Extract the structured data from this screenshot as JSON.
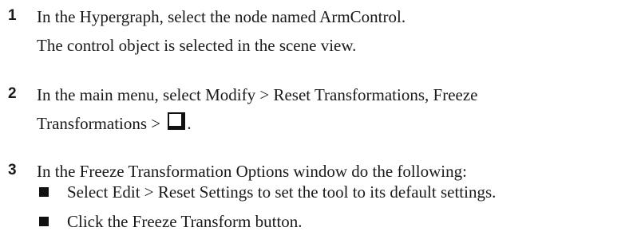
{
  "steps": [
    {
      "number": "1",
      "lines": [
        "In the Hypergraph, select the node named ArmControl.",
        "The control object is selected in the scene view."
      ]
    },
    {
      "number": "2",
      "line1": "In the main menu, select Modify > Reset Transformations, Freeze",
      "line2_before_icon": "Transformations > ",
      "line2_after_icon": ".",
      "icon": "option-box-icon"
    },
    {
      "number": "3",
      "line": "In the Freeze Transformation Options window do the following:",
      "bullets": [
        "Select Edit > Reset Settings to set the tool to its default settings.",
        "Click the Freeze Transform button."
      ]
    }
  ]
}
